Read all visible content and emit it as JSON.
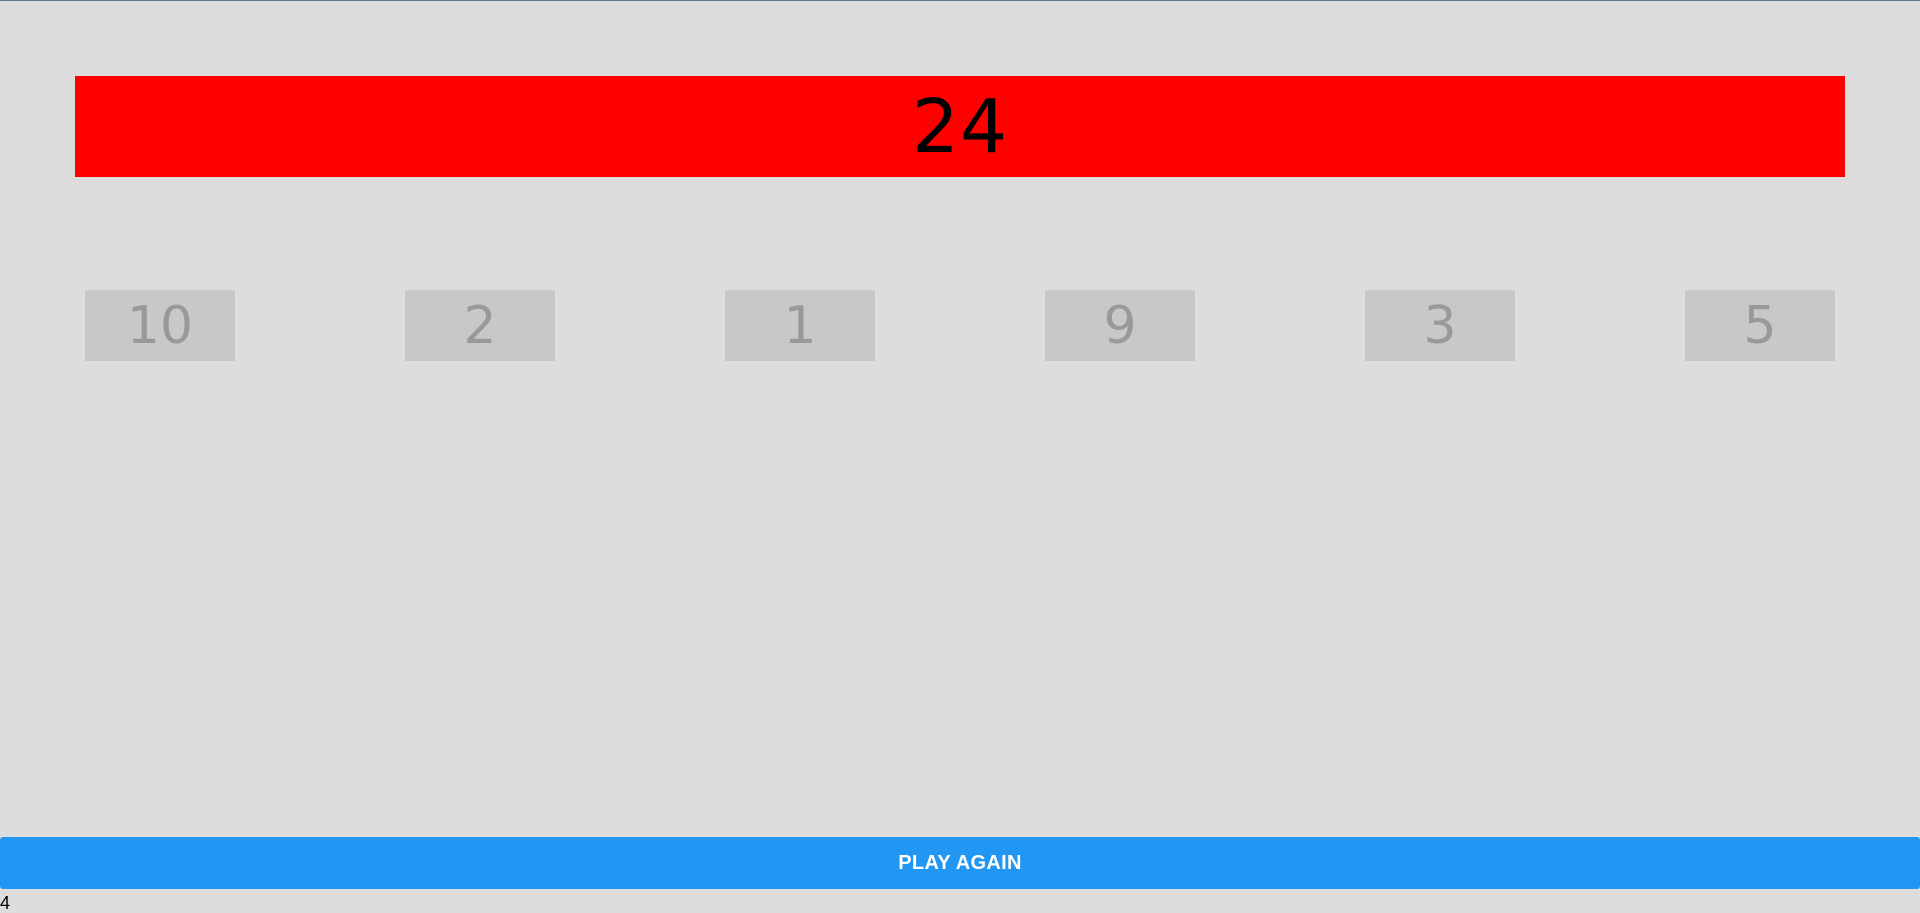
{
  "target": {
    "value": "24",
    "color": "#ff0000"
  },
  "numbers": [
    "10",
    "2",
    "1",
    "9",
    "3",
    "5"
  ],
  "play_again": {
    "label": "PLAY AGAIN",
    "color": "#2196f3"
  },
  "footer": {
    "text": "4"
  }
}
